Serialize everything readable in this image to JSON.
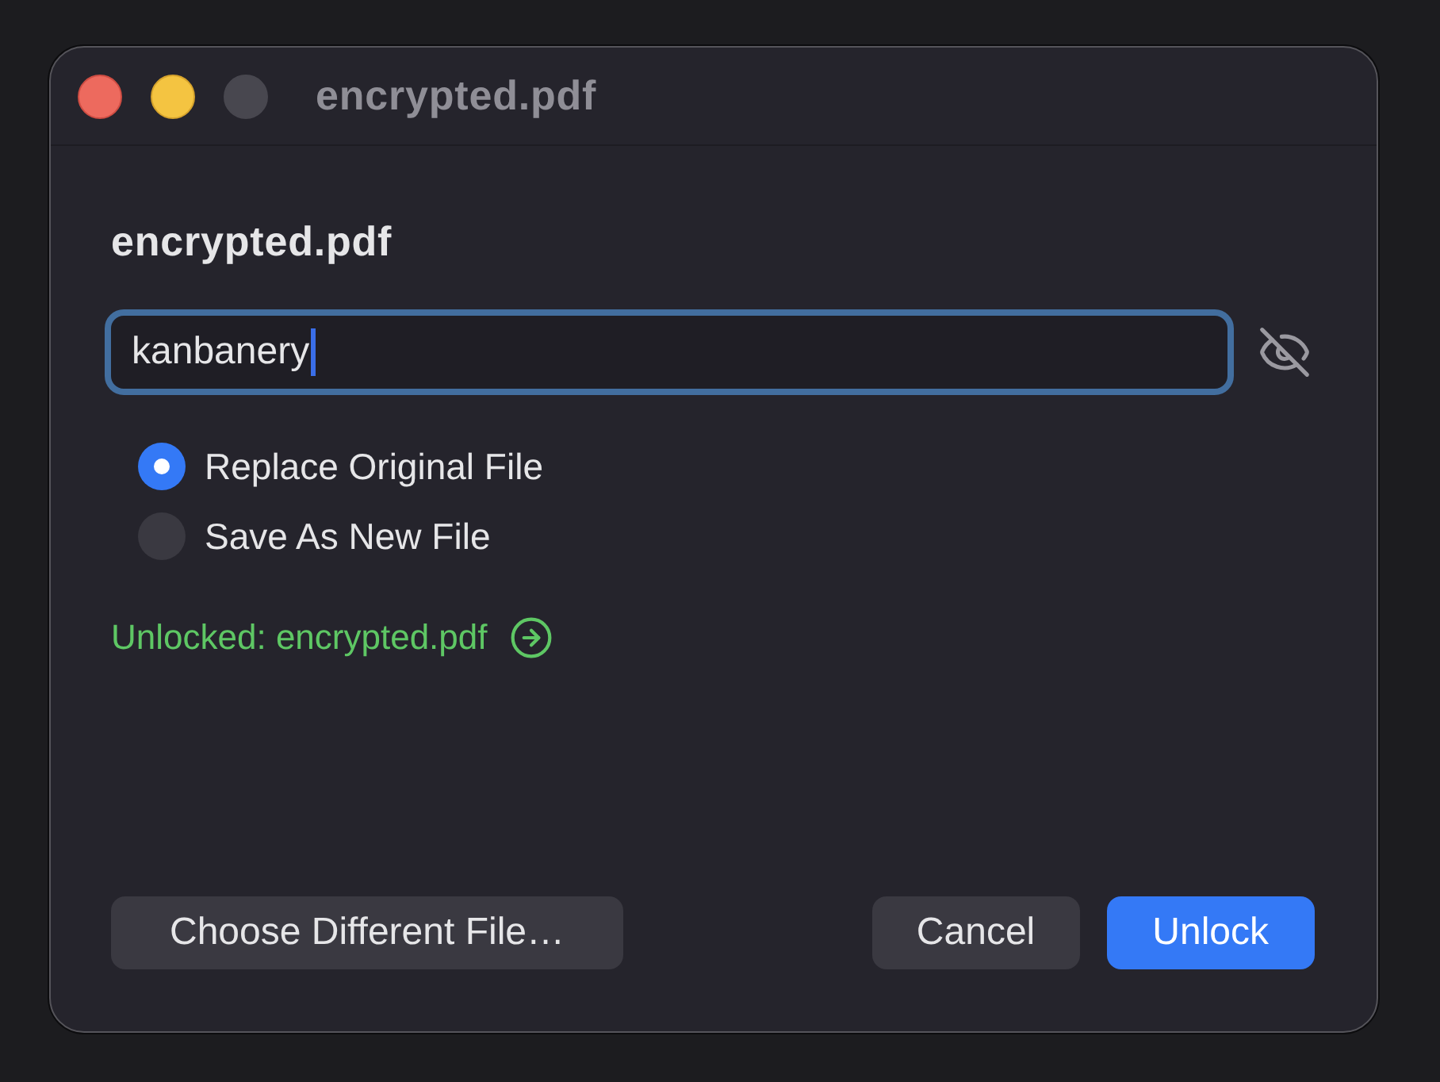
{
  "window": {
    "title": "encrypted.pdf",
    "controls": [
      {
        "kind": "close",
        "disabled": false
      },
      {
        "kind": "minimize",
        "disabled": false
      },
      {
        "kind": "zoom",
        "disabled": true
      }
    ]
  },
  "heading": "encrypted.pdf",
  "password_field": {
    "value": "kanbanery",
    "focused": true
  },
  "options": [
    {
      "label": "Replace Original File",
      "selected": true
    },
    {
      "label": "Save As New File",
      "selected": false
    }
  ],
  "status": {
    "kind": "success",
    "text": "Unlocked: encrypted.pdf"
  },
  "footer": {
    "secondary_action": {
      "label": "Choose Different File…"
    },
    "buttons": [
      {
        "label": "Cancel",
        "default": false
      },
      {
        "label": "Unlock",
        "default": true
      }
    ]
  }
}
